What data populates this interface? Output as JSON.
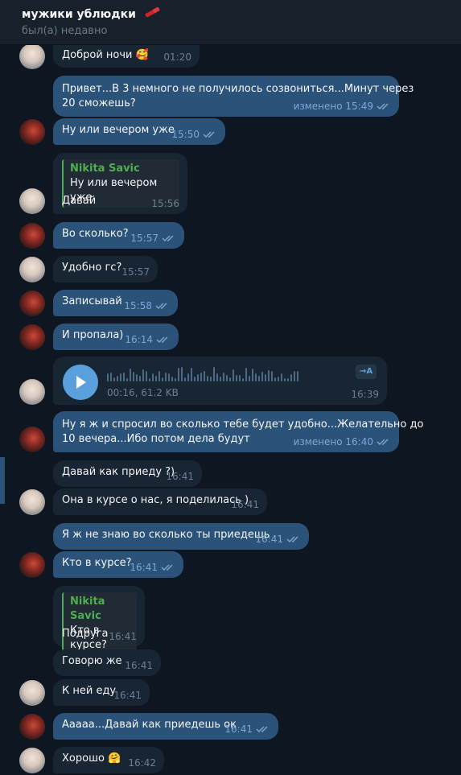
{
  "header": {
    "title": "мужики ублюдки",
    "status": "был(а) недавно",
    "title_icon": "lipstick-icon"
  },
  "colors": {
    "background": "#0e1621",
    "incoming": "#182533",
    "outgoing": "#2b5278",
    "reply_accent": "#4fae4e",
    "play_button": "#5aa0dc"
  },
  "messages": [
    {
      "text": "Доброй ночи",
      "emoji": "🥰",
      "time": "01:20"
    },
    {
      "text": "Привет...В 3 немного не получилось созвониться...Минут через",
      "text2": "20 сможешь?",
      "time": "изменено 15:49"
    },
    {
      "text": "Ну или вечером уже",
      "time": "15:50"
    },
    {
      "reply_name": "Nikita Savic",
      "reply_text": "Ну или вечером уже",
      "text": "Давай",
      "time": "15:56"
    },
    {
      "text": "Во сколько?",
      "time": "15:57"
    },
    {
      "text": "Удобно гс?",
      "time": "15:57"
    },
    {
      "text": "Записывай",
      "time": "15:58"
    },
    {
      "text": "И пропала)",
      "time": "16:14"
    },
    {
      "voice_info": "00:16, 61.2 KB",
      "transcribe": "→A",
      "time": "16:39"
    },
    {
      "text": "Ну я ж и спросил во сколько тебе будет удобно...Желательно до",
      "text2": "10 вечера...Ибо потом дела будут",
      "time": "изменено 16:40"
    },
    {
      "text": "Давай как приеду ?)",
      "time": "16:41"
    },
    {
      "text": "Она в курсе о нас, я поделилась )",
      "time": "16:41"
    },
    {
      "text": "Я ж не знаю во сколько ты приедешь",
      "time": "16:41"
    },
    {
      "text": "Кто в курсе?",
      "time": "16:41"
    },
    {
      "reply_name": "Nikita Savic",
      "reply_text": "Кто в курсе?",
      "text": "Подруга",
      "time": "16:41"
    },
    {
      "text": "Говорю  же",
      "time": "16:41"
    },
    {
      "text": "К ней еду",
      "time": "16:41"
    },
    {
      "text": "Ааааа...Давай как приедешь ок",
      "time": "16:41"
    },
    {
      "text": "Хорошо",
      "emoji": "🤗",
      "time": "16:42"
    }
  ]
}
